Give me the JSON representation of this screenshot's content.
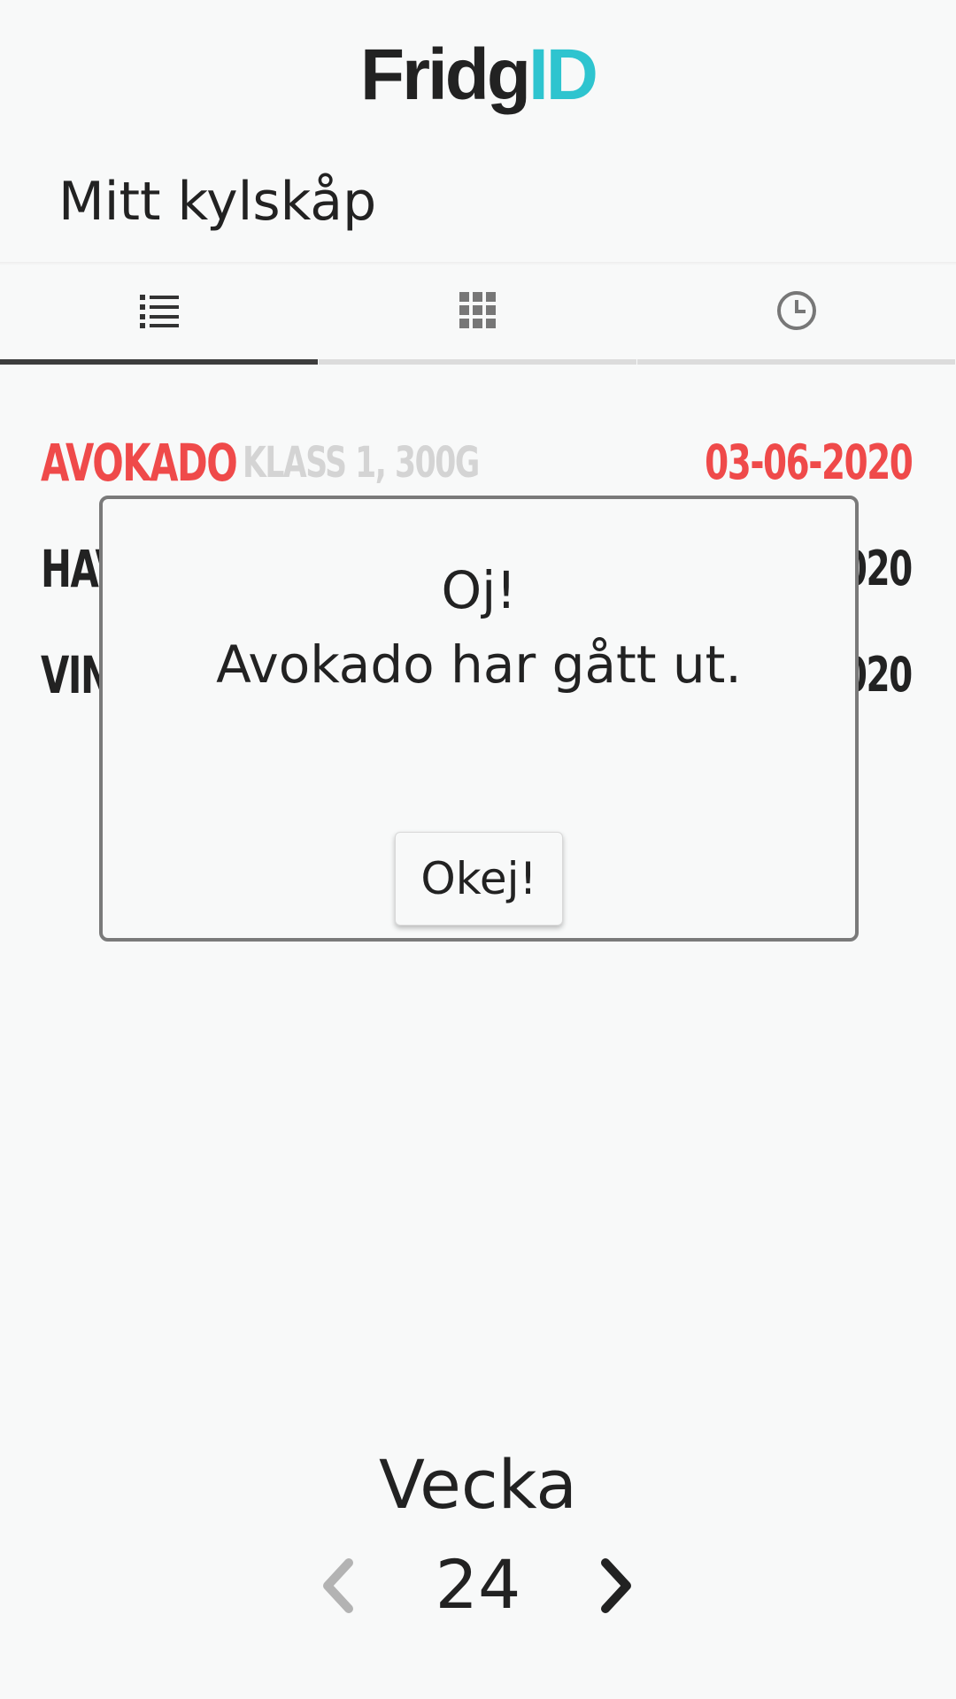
{
  "app": {
    "logo_part1": "Fridg",
    "logo_part2": "ID",
    "accent_color": "#2ec4cf"
  },
  "page_title": "Mitt kylskåp",
  "tabs": [
    {
      "icon": "list-icon",
      "active": true
    },
    {
      "icon": "grid-icon",
      "active": false
    },
    {
      "icon": "clock-icon",
      "active": false
    }
  ],
  "items": [
    {
      "name": "AVOKADO",
      "detail": "KLASS 1, 300G",
      "date": "03-06-2020",
      "expired": true
    },
    {
      "name": "HAV",
      "detail": "",
      "date": "020",
      "expired": false
    },
    {
      "name": "VIN",
      "detail": "",
      "date": "020",
      "expired": false
    }
  ],
  "dialog": {
    "title": "Oj!",
    "message": "Avokado har gått ut.",
    "button_label": "Okej!"
  },
  "week": {
    "label": "Vecka",
    "number": "24",
    "prev_icon": "chevron-left-icon",
    "next_icon": "chevron-right-icon"
  },
  "colors": {
    "expired": "#ef4a4a",
    "detail": "#d4d4d4",
    "text": "#222222"
  }
}
